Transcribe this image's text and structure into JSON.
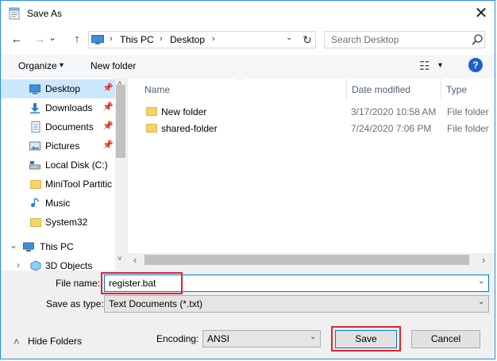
{
  "window": {
    "title": "Save As",
    "close_glyph": "✕"
  },
  "nav": {
    "back_glyph": "←",
    "forward_glyph": "→",
    "dropdown_glyph": "⌄",
    "up_glyph": "↑",
    "breadcrumb": [
      "This PC",
      "Desktop"
    ],
    "breadcrumb_sep": "›",
    "refresh_glyph": "↻",
    "search_placeholder": "Search Desktop"
  },
  "toolbar": {
    "organize_label": "Organize",
    "organize_arrow": "▾",
    "new_folder_label": "New folder",
    "view_glyph": "☷",
    "view_arrow": "▾",
    "help_label": "?"
  },
  "sidebar": {
    "items": [
      {
        "label": "Desktop",
        "icon": "desktop-icon",
        "pinned": true,
        "selected": true
      },
      {
        "label": "Downloads",
        "icon": "downloads-icon",
        "pinned": true
      },
      {
        "label": "Documents",
        "icon": "documents-icon",
        "pinned": true
      },
      {
        "label": "Pictures",
        "icon": "pictures-icon",
        "pinned": true
      },
      {
        "label": "Local Disk (C:)",
        "icon": "drive-icon"
      },
      {
        "label": "MiniTool Partitic",
        "icon": "folder-icon"
      },
      {
        "label": "Music",
        "icon": "music-icon"
      },
      {
        "label": "System32",
        "icon": "folder-icon"
      },
      {
        "label": "This PC",
        "icon": "pc-icon"
      },
      {
        "label": "3D Objects",
        "icon": "3d-objects-icon"
      }
    ],
    "pin_glyph": "📌",
    "expand_glyph": "›",
    "collapse_glyph": "⌄"
  },
  "files": {
    "columns": [
      "Name",
      "Date modified",
      "Type"
    ],
    "sort_glyph": "^",
    "rows": [
      {
        "name": "New folder",
        "date": "3/17/2020 10:58 AM",
        "type": "File folder"
      },
      {
        "name": "shared-folder",
        "date": "7/24/2020 7:06 PM",
        "type": "File folder"
      }
    ]
  },
  "scroll": {
    "left": "‹",
    "right": "›",
    "up": "˄",
    "down": "˅"
  },
  "form": {
    "file_name_label": "File name:",
    "file_name_value": "register.bat",
    "save_as_type_label": "Save as type:",
    "save_as_type_value": "Text Documents (*.txt)",
    "encoding_label": "Encoding:",
    "encoding_value": "ANSI",
    "dropdown_glyph": "⌄"
  },
  "footer": {
    "hide_folders_label": "Hide Folders",
    "hide_folders_glyph": "˄",
    "save_label": "Save",
    "cancel_label": "Cancel"
  },
  "colors": {
    "accent": "#0078d7",
    "highlight": "#e8202a",
    "selected": "#cce8ff"
  }
}
